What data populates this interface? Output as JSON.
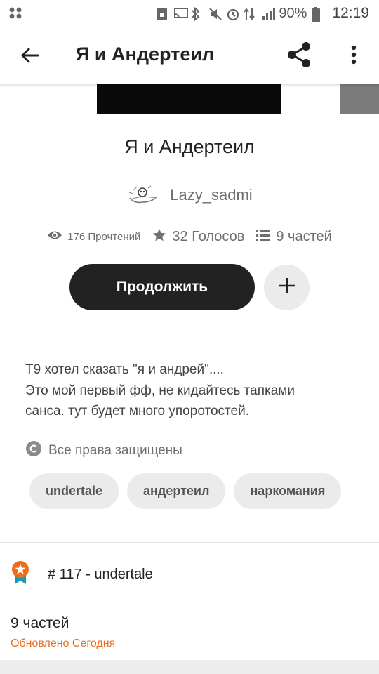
{
  "status_bar": {
    "battery_percent": "90%",
    "time": "12:19",
    "icons": [
      "grid-icon",
      "sim-lock-icon",
      "cast-icon",
      "bluetooth-icon",
      "mute-icon",
      "alarm-icon",
      "data-arrows-icon",
      "signal-icon",
      "battery-icon"
    ]
  },
  "app_bar": {
    "title": "Я и Андертеил",
    "back_icon": "arrow-back-icon",
    "share_icon": "share-icon",
    "more_icon": "more-vert-icon"
  },
  "story": {
    "title": "Я и Андертеил",
    "author": "Lazy_sadmi",
    "reads": "176 Прочтений",
    "votes": "32 Голосов",
    "parts": "9 частей",
    "continue_label": "Продолжить",
    "description_lines": [
      "Т9 хотел сказать \"я и андрей\"....",
      "Это мой первый фф, не кидайтесь тапками",
      "санса. тут будет много упоротостей."
    ],
    "rights": "Все права защищены",
    "tags": [
      "undertale",
      "андертеил",
      "наркомания"
    ],
    "rank": "# 117 - undertale",
    "parts_count": "9 частей",
    "updated": "Обновлено Сегодня"
  },
  "colors": {
    "accent_orange": "#f06b1a",
    "button_dark": "#222222",
    "chip_bg": "#ebebeb"
  }
}
